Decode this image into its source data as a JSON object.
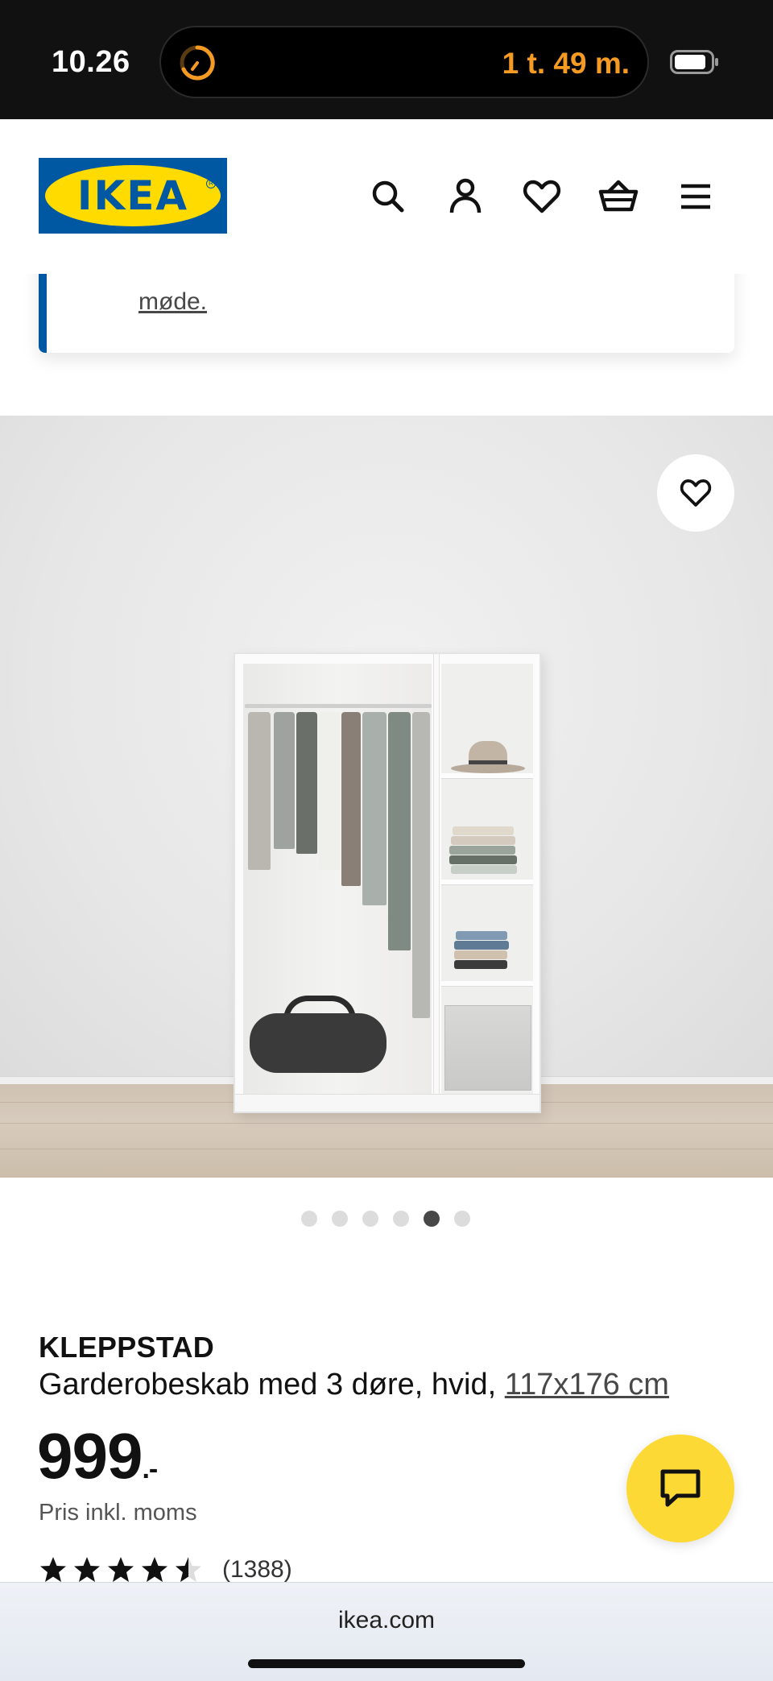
{
  "status_bar": {
    "time": "10.26",
    "timer": "1 t. 49 m.",
    "timer_color": "#f59a23"
  },
  "header": {
    "logo_text": "IKEA",
    "logo_colors": {
      "blue": "#0058a3",
      "yellow": "#ffdb00"
    },
    "icons": [
      "search-icon",
      "account-icon",
      "heart-icon",
      "basket-icon",
      "menu-icon"
    ]
  },
  "notice": {
    "link_text": "møde.",
    "accent_color": "#0058a3"
  },
  "product_image": {
    "carousel_total": 6,
    "carousel_active_index": 4
  },
  "product": {
    "name": "KLEPPSTAD",
    "description": "Garderobeskab med 3 døre, hvid, ",
    "size": "117x176 cm",
    "price": "999",
    "price_suffix": ".-",
    "price_note": "Pris inkl. moms",
    "rating_stars": 4.5,
    "review_count": "(1388)"
  },
  "chat": {
    "icon": "chat-icon",
    "color": "#fcd934"
  },
  "browser": {
    "url": "ikea.com"
  }
}
